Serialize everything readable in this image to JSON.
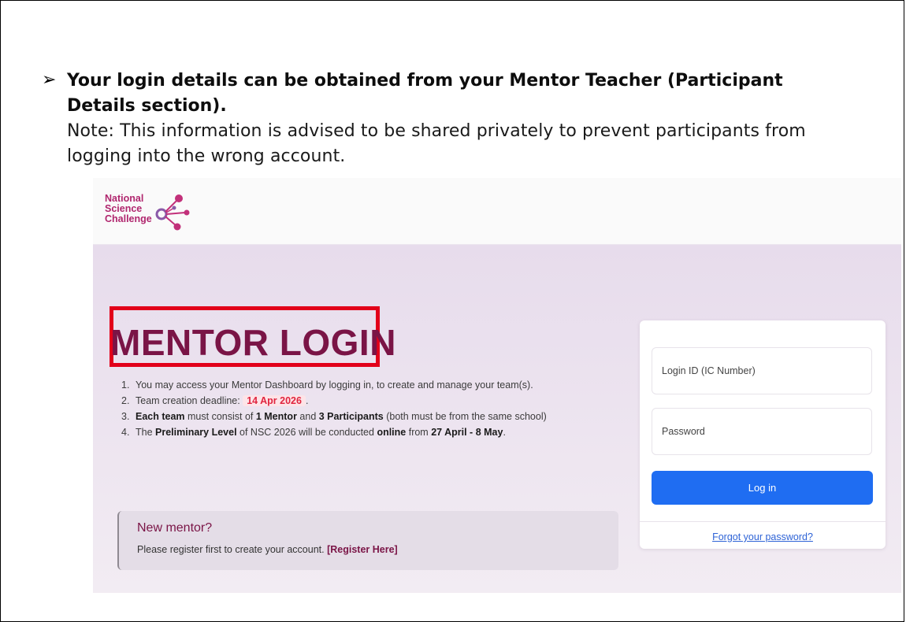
{
  "instruction": {
    "bullet_glyph": "➢",
    "title": "Your login details can be obtained from your Mentor Teacher (Participant Details section).",
    "note": "Note: This information is advised to be shared privately to prevent participants from logging into the wrong account."
  },
  "logo": {
    "line1": "National",
    "line2": "Science",
    "line3": "Challenge",
    "color": "#b0266e"
  },
  "hero": {
    "title": "MENTOR LOGIN",
    "rules": [
      {
        "num": "1.",
        "text": "You may access your Mentor Dashboard by logging in, to create and manage your team(s)."
      },
      {
        "num": "2.",
        "prefix": "Team creation deadline: ",
        "deadline": "14 Apr 2026",
        "suffix": "."
      },
      {
        "num": "3.",
        "bold1": "Each team",
        "mid1": " must consist of ",
        "bold2": "1 Mentor",
        "mid2": " and ",
        "bold3": "3 Participants",
        "suffix": " (both must be from the same school)"
      },
      {
        "num": "4.",
        "prefix": "The ",
        "bold1": "Preliminary Level",
        "mid1": " of NSC 2026 will be conducted ",
        "bold2": "online",
        "mid2": " from ",
        "bold3": "27 April - 8 May",
        "suffix": "."
      }
    ]
  },
  "new_mentor": {
    "title": "New mentor?",
    "text": "Please register first to create your account. ",
    "link": "[Register Here]"
  },
  "login": {
    "id_placeholder": "Login ID (IC Number)",
    "password_placeholder": "Password",
    "button_label": "Log in",
    "forgot_label": "Forgot your password?"
  },
  "colors": {
    "brand": "#7a1446",
    "highlight_box": "#e2001a",
    "button": "#1f6df2",
    "deadline": "#e0253f"
  }
}
